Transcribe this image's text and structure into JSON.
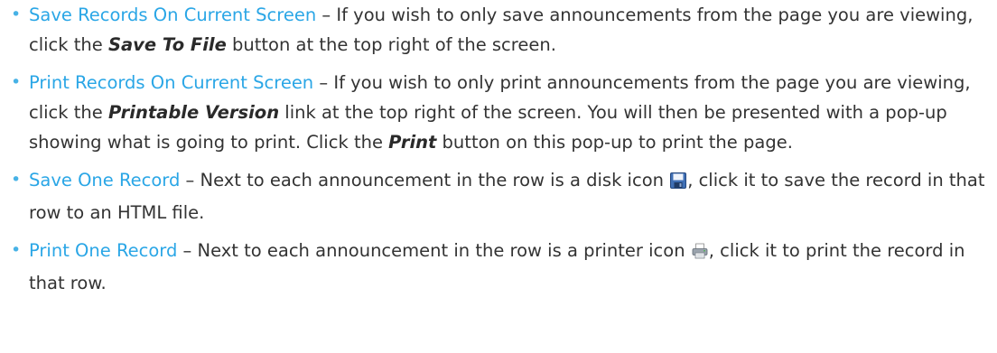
{
  "items": [
    {
      "term": "Save Records On Current Screen",
      "p1": " – If you wish to only save announcements from the page you are viewing, click the ",
      "e1": "Save To File",
      "p2": " button at the top right of the screen."
    },
    {
      "term": "Print Records On Current Screen",
      "p1": " – If you wish to only print announcements from the page you are viewing, click the ",
      "e1": "Printable Version",
      "p2": " link at the top right of the screen. You will then be presented with a pop-up showing what is going to print. Click the ",
      "e2": "Print",
      "p3": " button on this pop-up to print the page."
    },
    {
      "term": "Save One Record",
      "p1": " – Next to each announcement in the row is a disk icon ",
      "icon": "disk-icon",
      "p2": ", click it to save the record in that row to an HTML file."
    },
    {
      "term": "Print One Record",
      "p1": " – Next to each announcement in the row is a printer icon ",
      "icon": "printer-icon",
      "p2": ", click it to print the record in that row."
    }
  ],
  "colors": {
    "term": "#2aa6e6",
    "bullet": "#47b2e6",
    "body_text": "#333333"
  }
}
